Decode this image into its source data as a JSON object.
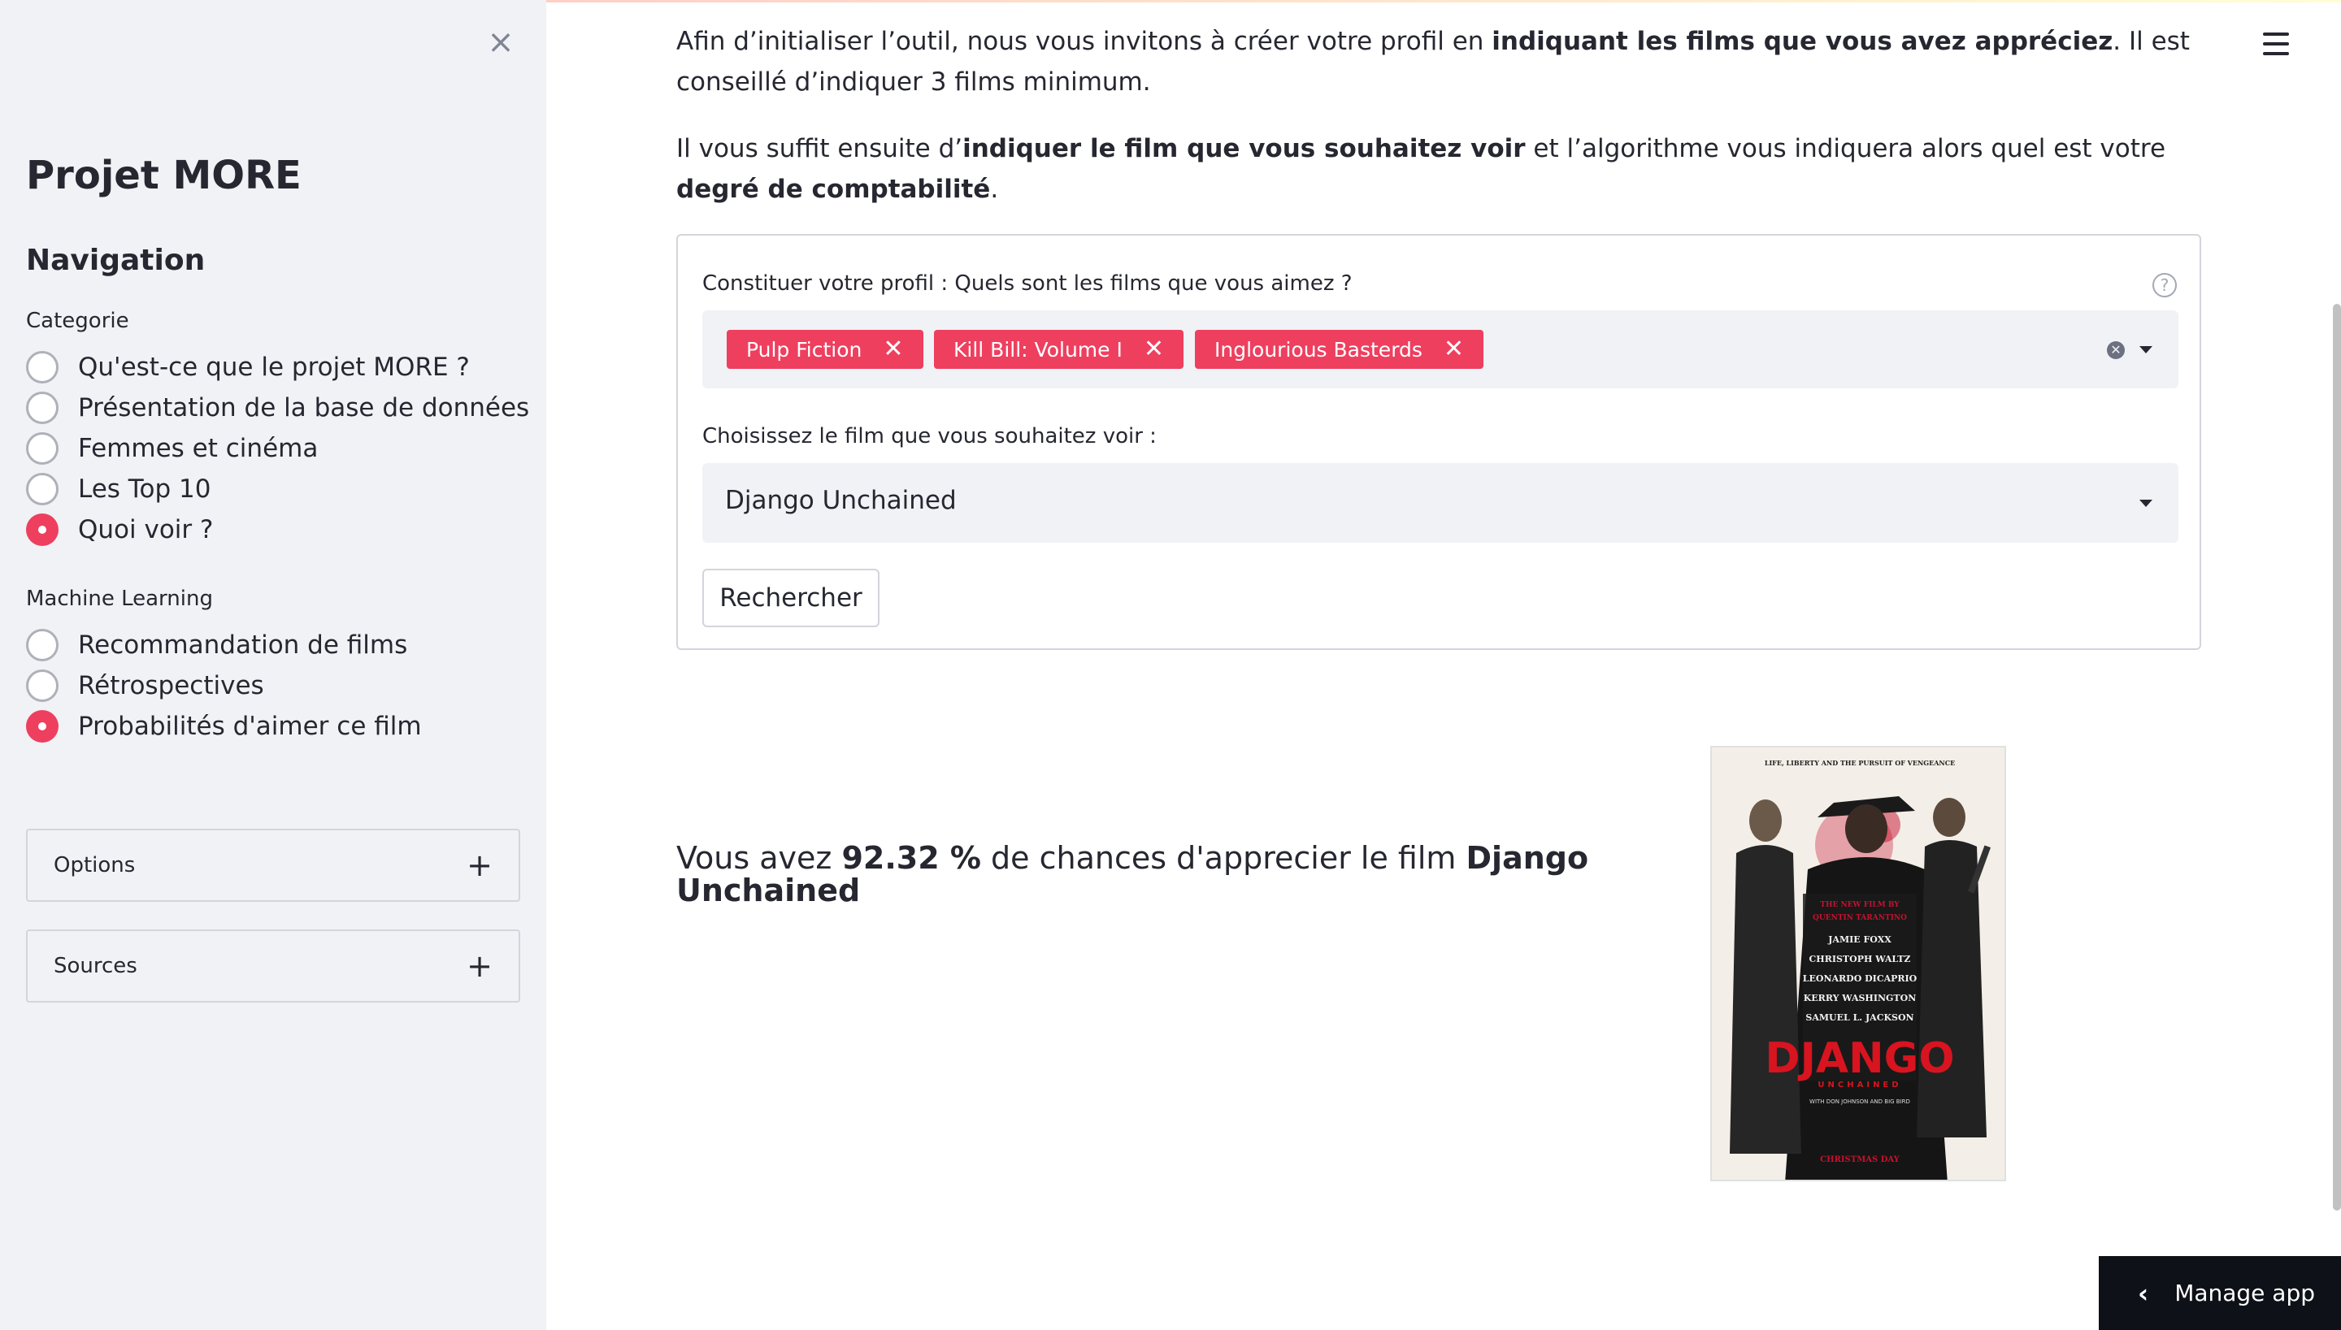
{
  "sidebar": {
    "close_icon": "×",
    "title": "Projet MORE",
    "subtitle": "Navigation",
    "categorie": {
      "label": "Categorie",
      "options": [
        {
          "label": "Qu'est-ce que le projet MORE ?",
          "checked": false
        },
        {
          "label": "Présentation de la base de données",
          "checked": false
        },
        {
          "label": "Femmes et cinéma",
          "checked": false
        },
        {
          "label": "Les Top 10",
          "checked": false
        },
        {
          "label": "Quoi voir ?",
          "checked": true
        }
      ]
    },
    "ml": {
      "label": "Machine Learning",
      "options": [
        {
          "label": "Recommandation de films",
          "checked": false
        },
        {
          "label": "Rétrospectives",
          "checked": false
        },
        {
          "label": "Probabilités d'aimer ce film",
          "checked": true
        }
      ]
    },
    "expanders": [
      {
        "label": "Options",
        "icon": "+"
      },
      {
        "label": "Sources",
        "icon": "+"
      }
    ]
  },
  "main": {
    "intro": {
      "p1_a": "Afin d’initialiser l’outil, nous vous invitons à créer votre profil en ",
      "p1_b": "indiquant les films que vous avez appréciez",
      "p1_c": ". Il est conseillé d’indiquer 3 films minimum.",
      "p2_a": "Il vous suffit ensuite d’",
      "p2_b": "indiquer le film que vous souhaitez voir",
      "p2_c": " et l’algorithme vous indiquera alors quel est votre ",
      "p2_d": "degré de comptabilité",
      "p2_e": "."
    },
    "profile_field": {
      "label": "Constituer votre profil : Quels sont les films que vous aimez ?",
      "help_icon": "?",
      "chips": [
        "Pulp Fiction",
        "Kill Bill: Volume I",
        "Inglourious Basterds"
      ],
      "chip_remove_icon": "✕",
      "clear_icon": "✕"
    },
    "film_select": {
      "label": "Choisissez le film que vous souhaitez voir :",
      "value": "Django Unchained"
    },
    "search_button": "Rechercher",
    "result": {
      "a": "Vous avez ",
      "b": "92.32 %",
      "c": " de chances d'apprecier le film ",
      "d": "Django Unchained"
    },
    "poster": {
      "tagline": "LIFE, LIBERTY AND THE PURSUIT OF VENGEANCE",
      "new_film_by": "THE NEW FILM BY",
      "director": "QUENTIN TARANTINO",
      "cast": [
        "JAMIE FOXX",
        "CHRISTOPH WALTZ",
        "LEONARDO DICAPRIO",
        "KERRY WASHINGTON",
        "SAMUEL L. JACKSON"
      ],
      "title": "DJANGO",
      "subtitle": "UNCHAINED",
      "cast_small": "WITH DON JOHNSON AND BIG BIRD",
      "release": "CHRISTMAS DAY"
    }
  },
  "manage_app": {
    "label": "Manage app",
    "icon": "‹"
  },
  "colors": {
    "accent": "#ee3f5f",
    "sidebar_bg": "#f0f2f6",
    "text": "#262730",
    "manage_bg": "#0e1117"
  }
}
